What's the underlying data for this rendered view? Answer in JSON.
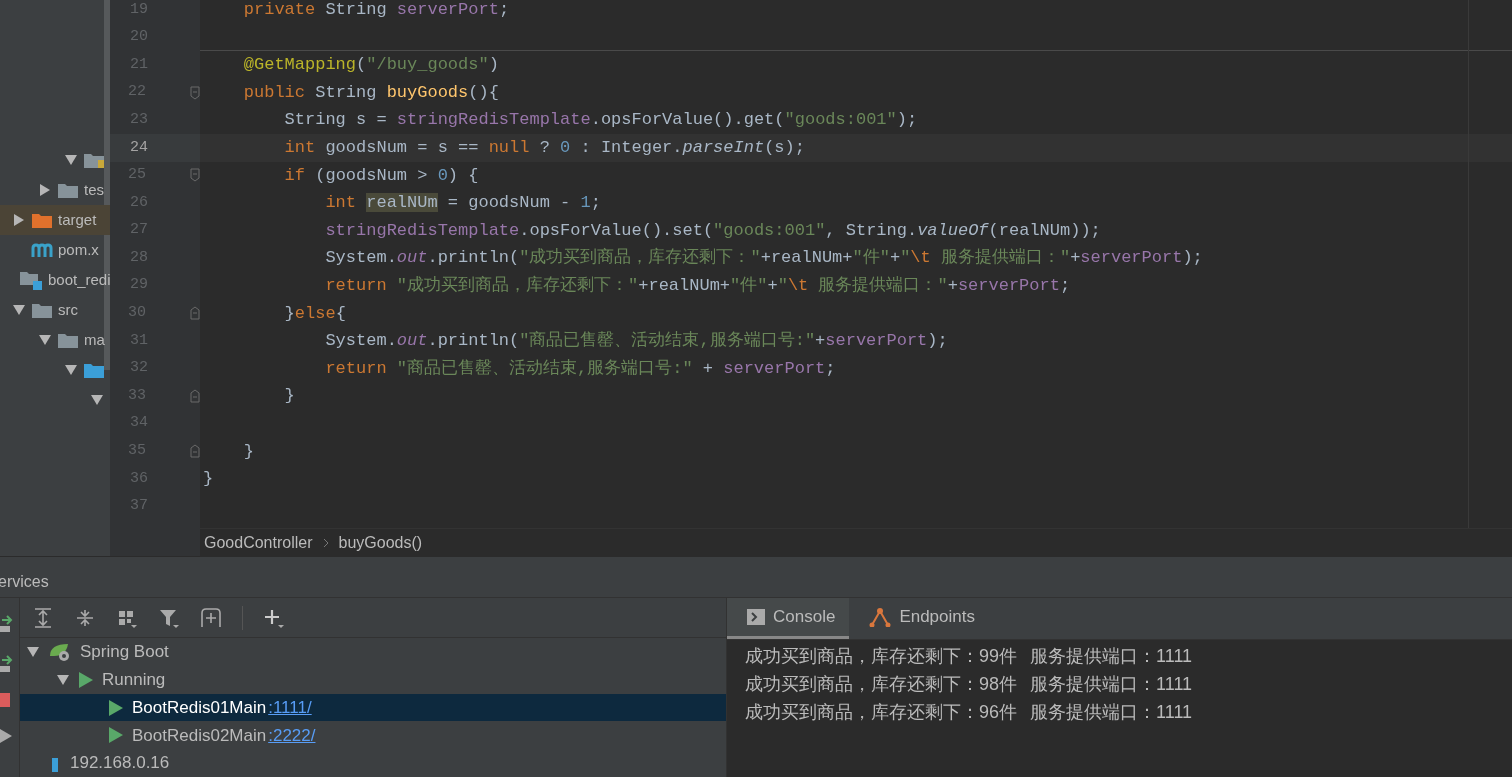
{
  "project_tree": [
    {
      "children": [
        {
          "children": [
            {
              "children": [
                {
                  "kind": "package",
                  "expanded": true,
                  "selected": false
                }
              ]
            },
            {
              "kind": "folder",
              "label": "tes",
              "expanded": false,
              "selected": false
            }
          ]
        },
        {
          "kind": "folder-excluded",
          "label": "target",
          "expanded": false,
          "selected": true
        },
        {
          "kind": "maven",
          "label": "pom.x",
          "selected": false
        }
      ]
    },
    {
      "kind": "module",
      "label": "boot_redi",
      "selected": false,
      "children": [
        {
          "kind": "folder",
          "label": "src",
          "expanded": true,
          "selected": false,
          "children": [
            {
              "kind": "folder",
              "label": "ma",
              "expanded": true,
              "selected": false,
              "children": [
                {
                  "kind": "folder-source",
                  "expanded": true,
                  "selected": false,
                  "children": [
                    {
                      "expanded": true,
                      "selected": false
                    }
                  ]
                }
              ]
            }
          ]
        }
      ]
    }
  ],
  "editor": {
    "lines": [
      {
        "number": "19",
        "current": false,
        "tokens": [
          {
            "kind": "kw",
            "text": "    private"
          },
          {
            "kind": "plain",
            "text": " String "
          },
          {
            "kind": "field",
            "text": "serverPort"
          },
          {
            "kind": "plain",
            "text": ";"
          }
        ]
      },
      {
        "number": "20",
        "current": false,
        "separator": true
      },
      {
        "number": "21",
        "current": false,
        "tokens": [
          {
            "kind": "ann",
            "text": "    @GetMapping"
          },
          {
            "kind": "plain",
            "text": "("
          },
          {
            "kind": "str",
            "text": "\"/buy_goods\""
          },
          {
            "kind": "plain",
            "text": ")"
          }
        ]
      },
      {
        "number": "22",
        "current": false,
        "fold_start": true,
        "tokens": [
          {
            "kind": "kw",
            "text": "    public"
          },
          {
            "kind": "plain",
            "text": " String "
          },
          {
            "kind": "decl",
            "text": "buyGoods"
          },
          {
            "kind": "plain",
            "text": "(){"
          }
        ]
      },
      {
        "number": "23",
        "current": false,
        "tokens": [
          {
            "kind": "plain",
            "text": "        String s = "
          },
          {
            "kind": "field",
            "text": "stringRedisTemplate"
          },
          {
            "kind": "plain",
            "text": ".opsForValue().get("
          },
          {
            "kind": "str",
            "text": "\"goods:001\""
          },
          {
            "kind": "plain",
            "text": ");"
          }
        ]
      },
      {
        "number": "24",
        "current": true,
        "tokens": [
          {
            "kind": "kw",
            "text": "        int"
          },
          {
            "kind": "plain",
            "text": " goodsNum = s == "
          },
          {
            "kind": "kw",
            "text": "null"
          },
          {
            "kind": "plain",
            "text": " ? "
          },
          {
            "kind": "num",
            "text": "0"
          },
          {
            "kind": "plain",
            "text": " : Integer."
          },
          {
            "kind": "ital",
            "text": "parseInt"
          },
          {
            "kind": "plain",
            "text": "(s);"
          }
        ]
      },
      {
        "number": "25",
        "current": false,
        "fold_start": true,
        "tokens": [
          {
            "kind": "kw",
            "text": "        if"
          },
          {
            "kind": "plain",
            "text": " (goodsNum > "
          },
          {
            "kind": "num",
            "text": "0"
          },
          {
            "kind": "plain",
            "text": ") {"
          }
        ]
      },
      {
        "number": "26",
        "current": false,
        "tokens": [
          {
            "kind": "kw",
            "text": "            int "
          },
          {
            "kind": "hl",
            "text": "realNUm"
          },
          {
            "kind": "plain",
            "text": " = goodsNum - "
          },
          {
            "kind": "num",
            "text": "1"
          },
          {
            "kind": "plain",
            "text": ";"
          }
        ]
      },
      {
        "number": "27",
        "current": false,
        "tokens": [
          {
            "kind": "field",
            "text": "            stringRedisTemplate"
          },
          {
            "kind": "plain",
            "text": ".opsForValue().set("
          },
          {
            "kind": "str",
            "text": "\"goods:001\""
          },
          {
            "kind": "plain",
            "text": ", String."
          },
          {
            "kind": "ital",
            "text": "valueOf"
          },
          {
            "kind": "plain",
            "text": "(realNUm));"
          }
        ]
      },
      {
        "number": "28",
        "current": false,
        "tokens": [
          {
            "kind": "plain",
            "text": "            System."
          },
          {
            "kind": "sfield",
            "text": "out"
          },
          {
            "kind": "plain",
            "text": ".println("
          },
          {
            "kind": "str",
            "text": "\"成功买到商品，库存还剩下：\""
          },
          {
            "kind": "plain",
            "text": "+realNUm+"
          },
          {
            "kind": "str",
            "text": "\"件\""
          },
          {
            "kind": "plain",
            "text": "+"
          },
          {
            "kind": "str",
            "text": "\""
          },
          {
            "kind": "esc",
            "text": "\\t"
          },
          {
            "kind": "str",
            "text": " 服务提供端口：\""
          },
          {
            "kind": "plain",
            "text": "+"
          },
          {
            "kind": "field",
            "text": "serverPort"
          },
          {
            "kind": "plain",
            "text": ");"
          }
        ]
      },
      {
        "number": "29",
        "current": false,
        "tokens": [
          {
            "kind": "kw",
            "text": "            return "
          },
          {
            "kind": "str",
            "text": "\"成功买到商品，库存还剩下：\""
          },
          {
            "kind": "plain",
            "text": "+realNUm+"
          },
          {
            "kind": "str",
            "text": "\"件\""
          },
          {
            "kind": "plain",
            "text": "+"
          },
          {
            "kind": "str",
            "text": "\""
          },
          {
            "kind": "esc",
            "text": "\\t"
          },
          {
            "kind": "str",
            "text": " 服务提供端口：\""
          },
          {
            "kind": "plain",
            "text": "+"
          },
          {
            "kind": "field",
            "text": "serverPort"
          },
          {
            "kind": "plain",
            "text": ";"
          }
        ]
      },
      {
        "number": "30",
        "current": false,
        "fold_start": true,
        "fold_end": true,
        "tokens": [
          {
            "kind": "plain",
            "text": "        }"
          },
          {
            "kind": "kw",
            "text": "else"
          },
          {
            "kind": "plain",
            "text": "{"
          }
        ]
      },
      {
        "number": "31",
        "current": false,
        "tokens": [
          {
            "kind": "plain",
            "text": "            System."
          },
          {
            "kind": "sfield",
            "text": "out"
          },
          {
            "kind": "plain",
            "text": ".println("
          },
          {
            "kind": "str",
            "text": "\"商品已售罄、活动结束,服务端口号:\""
          },
          {
            "kind": "plain",
            "text": "+"
          },
          {
            "kind": "field",
            "text": "serverPort"
          },
          {
            "kind": "plain",
            "text": ");"
          }
        ]
      },
      {
        "number": "32",
        "current": false,
        "tokens": [
          {
            "kind": "kw",
            "text": "            return "
          },
          {
            "kind": "str",
            "text": "\"商品已售罄、活动结束,服务端口号:\""
          },
          {
            "kind": "plain",
            "text": " + "
          },
          {
            "kind": "field",
            "text": "serverPort"
          },
          {
            "kind": "plain",
            "text": ";"
          }
        ]
      },
      {
        "number": "33",
        "current": false,
        "fold_end": true,
        "tokens": [
          {
            "kind": "plain",
            "text": "        }"
          }
        ]
      },
      {
        "number": "34",
        "current": false
      },
      {
        "number": "35",
        "current": false,
        "fold_end": true,
        "tokens": [
          {
            "kind": "plain",
            "text": "    }"
          }
        ]
      },
      {
        "number": "36",
        "current": false,
        "tokens": [
          {
            "kind": "plain",
            "text": "}"
          }
        ]
      },
      {
        "number": "37",
        "current": false
      }
    ],
    "breadcrumbs": [
      "GoodController",
      "buyGoods()"
    ]
  },
  "services": {
    "title": "ervices",
    "tree": [
      {
        "label": "Spring Boot",
        "kind": "spring",
        "expanded": true,
        "selected": false,
        "children": [
          {
            "label": "Running",
            "kind": "run",
            "expanded": true,
            "selected": false,
            "children": [
              {
                "label": "BootRedis01Main",
                "link": ":1111/",
                "kind": "run",
                "selected": true
              },
              {
                "label": "BootRedis02Main",
                "link": ":2222/",
                "kind": "run",
                "selected": false
              }
            ]
          }
        ]
      },
      {
        "label": "192.168.0.16",
        "kind": "host",
        "selected": false
      }
    ],
    "tabs": [
      {
        "label": "Console",
        "kind": "console",
        "selected": true
      },
      {
        "label": "Endpoints",
        "kind": "endpoints",
        "selected": false
      }
    ],
    "console_lines": [
      "成功买到商品，库存还剩下：99件\t服务提供端口：1111",
      "成功买到商品，库存还剩下：98件\t服务提供端口：1111",
      "成功买到商品，库存还剩下：96件\t服务提供端口：1111"
    ]
  }
}
